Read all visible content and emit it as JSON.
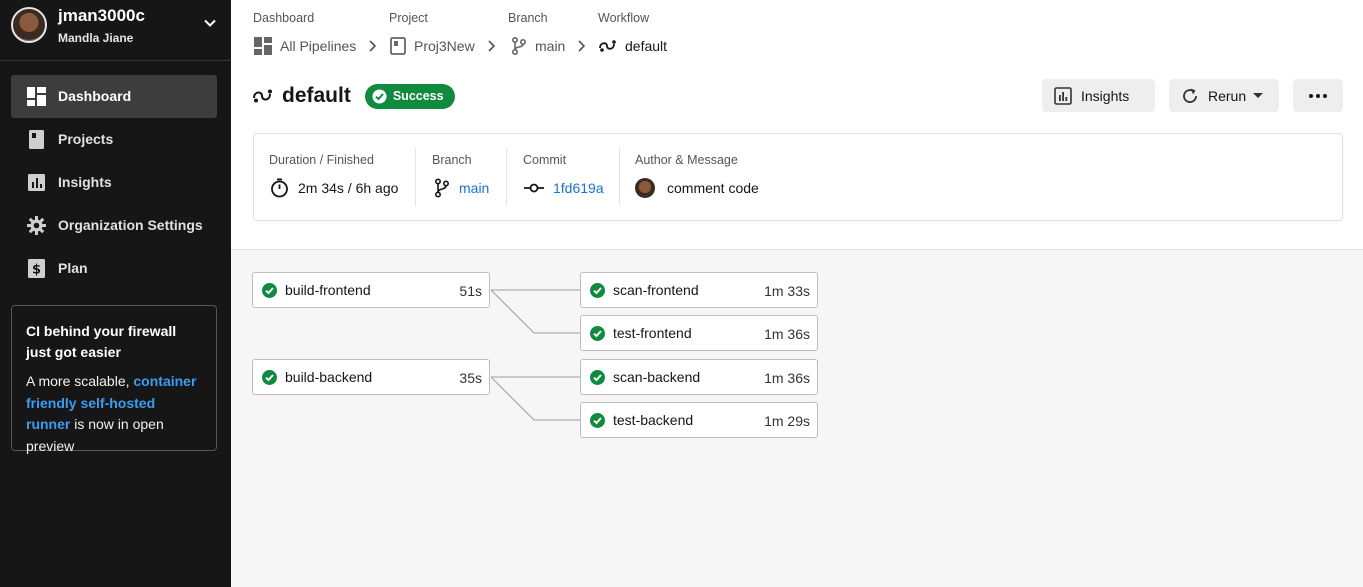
{
  "user": {
    "login": "jman3000c",
    "name": "Mandla Jiane"
  },
  "sidebar": {
    "items": [
      {
        "label": "Dashboard",
        "icon": "dashboard-icon",
        "active": true
      },
      {
        "label": "Projects",
        "icon": "projects-icon",
        "active": false
      },
      {
        "label": "Insights",
        "icon": "insights-icon",
        "active": false
      },
      {
        "label": "Organization Settings",
        "icon": "gear-icon",
        "active": false
      },
      {
        "label": "Plan",
        "icon": "plan-icon",
        "active": false
      }
    ],
    "promo": {
      "title": "CI behind your firewall just got easier",
      "body_prefix": "A more scalable,",
      "link": "container friendly self-hosted runner",
      "body_suffix": "is now in open preview"
    }
  },
  "breadcrumb": {
    "labels": [
      "Dashboard",
      "Project",
      "Branch",
      "Workflow"
    ],
    "values": [
      "All Pipelines",
      "Proj3New",
      "main",
      "default"
    ]
  },
  "workflow": {
    "title": "default",
    "status": "Success",
    "status_color": "#0f8a3f"
  },
  "actions": {
    "insights": "Insights",
    "rerun": "Rerun",
    "more": "more-icon"
  },
  "summary": {
    "duration_label": "Duration / Finished",
    "duration_value": "2m 34s / 6h ago",
    "branch_label": "Branch",
    "branch_value": "main",
    "commit_label": "Commit",
    "commit_value": "1fd619a",
    "author_label": "Author & Message",
    "author_message": "comment code"
  },
  "jobs": [
    {
      "name": "build-frontend",
      "duration": "51s",
      "status": "success"
    },
    {
      "name": "scan-frontend",
      "duration": "1m 33s",
      "status": "success"
    },
    {
      "name": "test-frontend",
      "duration": "1m 36s",
      "status": "success"
    },
    {
      "name": "build-backend",
      "duration": "35s",
      "status": "success"
    },
    {
      "name": "scan-backend",
      "duration": "1m 36s",
      "status": "success"
    },
    {
      "name": "test-backend",
      "duration": "1m 29s",
      "status": "success"
    }
  ],
  "colors": {
    "sidebar_bg": "#161616",
    "accent_link": "#1a73c9",
    "success": "#0f8a3f",
    "promo_link": "#3a9cf2"
  }
}
